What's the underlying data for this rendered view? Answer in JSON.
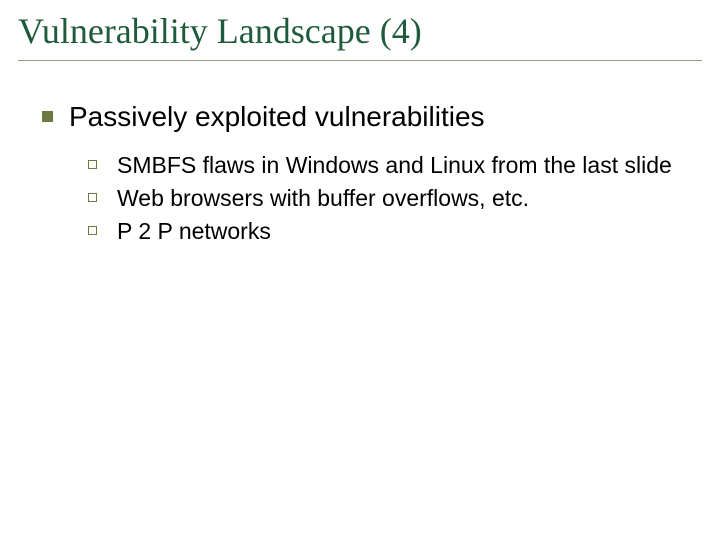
{
  "title": "Vulnerability Landscape (4)",
  "main": {
    "heading": "Passively exploited vulnerabilities",
    "items": [
      "SMBFS flaws in Windows and Linux from the last slide",
      "Web browsers with buffer overflows, etc.",
      "P 2 P networks"
    ]
  }
}
